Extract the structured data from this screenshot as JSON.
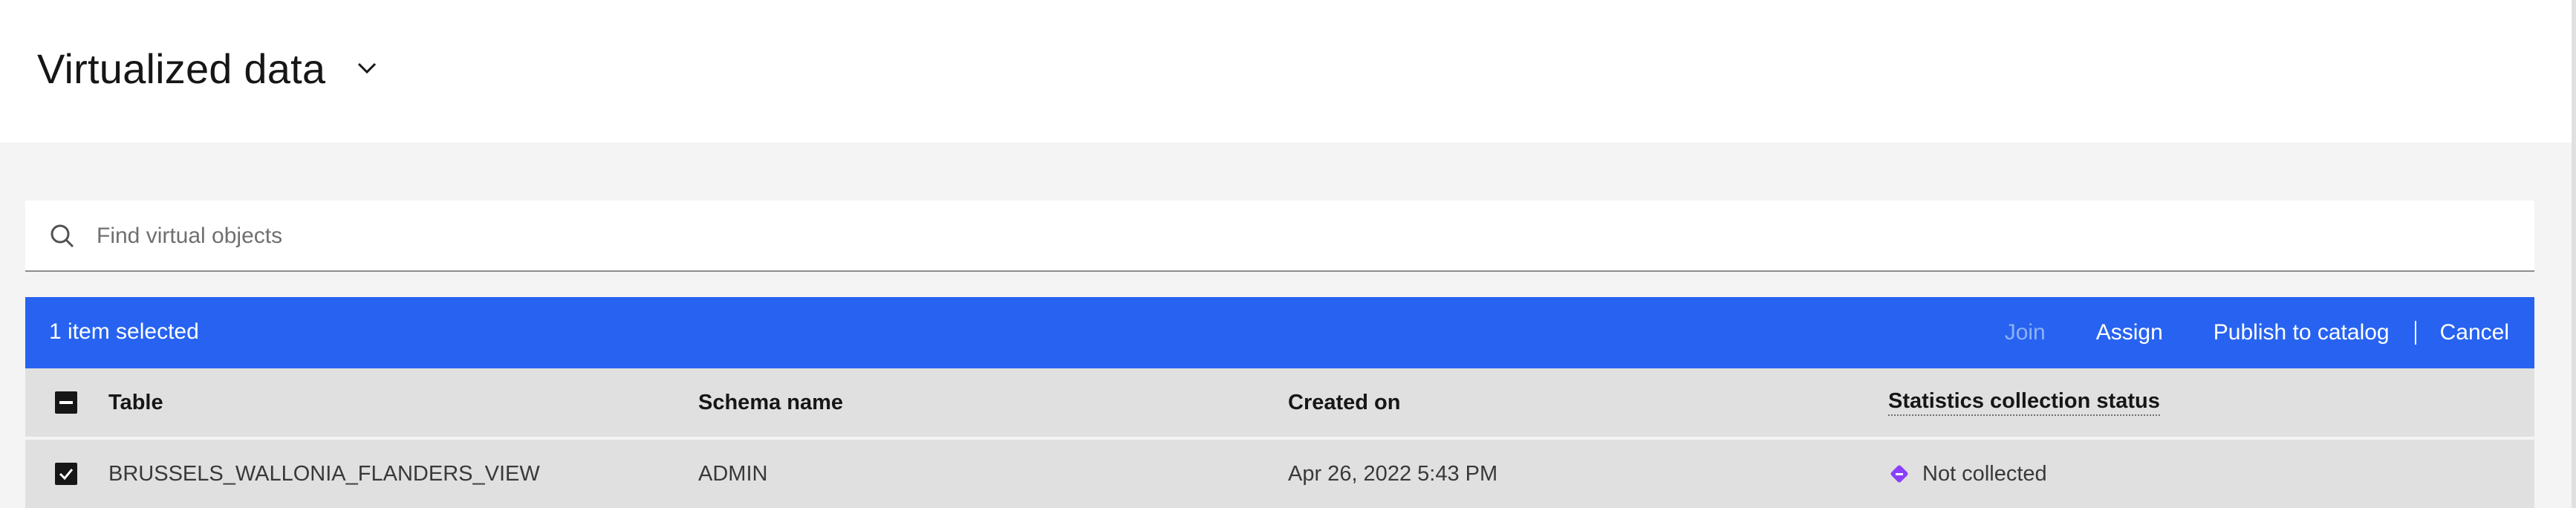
{
  "header": {
    "title": "Virtualized data",
    "dropdown_icon": "chevron-down-icon"
  },
  "search": {
    "icon": "search-icon",
    "placeholder": "Find virtual objects",
    "value": ""
  },
  "batch_bar": {
    "selected_text": "1 item selected",
    "actions": {
      "join": "Join",
      "assign": "Assign",
      "publish": "Publish to catalog",
      "cancel": "Cancel"
    },
    "color": "#2763f0"
  },
  "table": {
    "columns": {
      "table": "Table",
      "schema": "Schema name",
      "created": "Created on",
      "stats": "Statistics collection status"
    },
    "rows": [
      {
        "table": "BRUSSELS_WALLONIA_FLANDERS_VIEW",
        "schema": "ADMIN",
        "created": "Apr 26, 2022 5:43 PM",
        "stats": "Not collected",
        "stats_icon": "diamond-status-icon",
        "stats_color": "#8a3ffc",
        "selected": true
      }
    ]
  }
}
